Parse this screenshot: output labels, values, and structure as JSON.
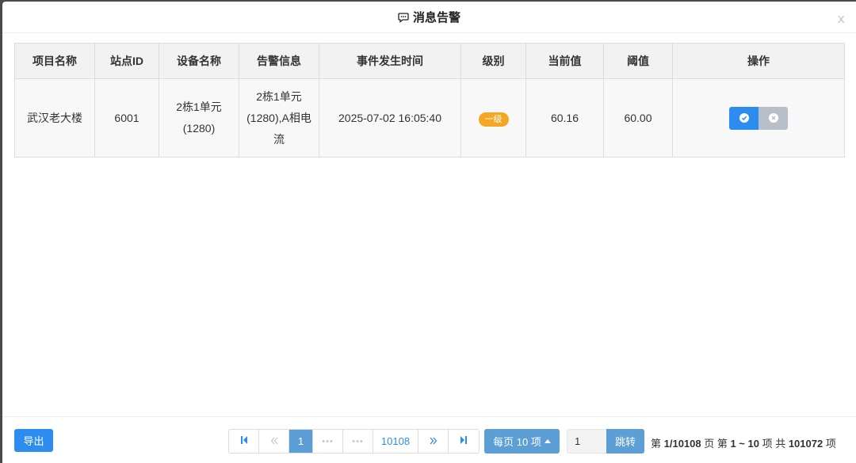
{
  "dialog": {
    "title": "消息告警",
    "close_label": "x"
  },
  "table": {
    "columns": [
      "项目名称",
      "站点ID",
      "设备名称",
      "告警信息",
      "事件发生时间",
      "级别",
      "当前值",
      "阈值",
      "操作"
    ],
    "rows": [
      {
        "project": "武汉老大楼",
        "site_id": "6001",
        "device_line1": "2栋1单元",
        "device_line2": "(1280)",
        "alarm_line1": "2栋1单元",
        "alarm_line2": "(1280),A相电",
        "alarm_line3": "流",
        "time": "2025-07-02 16:05:40",
        "level": "一级",
        "current": "60.16",
        "threshold": "60.00"
      }
    ]
  },
  "footer": {
    "export_label": "导出",
    "pagination": {
      "current_page": "1",
      "last_page": "10108",
      "ellipsis": "•••"
    },
    "per_page_label": "每页 10 项",
    "jump_value": "1",
    "jump_label": "跳转",
    "summary": {
      "page_prefix": "第 ",
      "page_value": "1/10108",
      "page_suffix": " 页  第 ",
      "range_value": "1 ~ 10",
      "range_suffix": " 项  共 ",
      "total_value": "101072",
      "total_suffix": " 项"
    }
  },
  "colors": {
    "primary": "#2d8cf0",
    "light_primary": "#5b9fd6",
    "badge": "#f5a623",
    "cancel": "#b7c0c9"
  },
  "icons": [
    "chat-icon",
    "close-icon",
    "check-icon",
    "x-icon",
    "first-page-icon",
    "prev-page-icon",
    "next-page-icon",
    "last-page-icon",
    "caret-up-icon"
  ]
}
